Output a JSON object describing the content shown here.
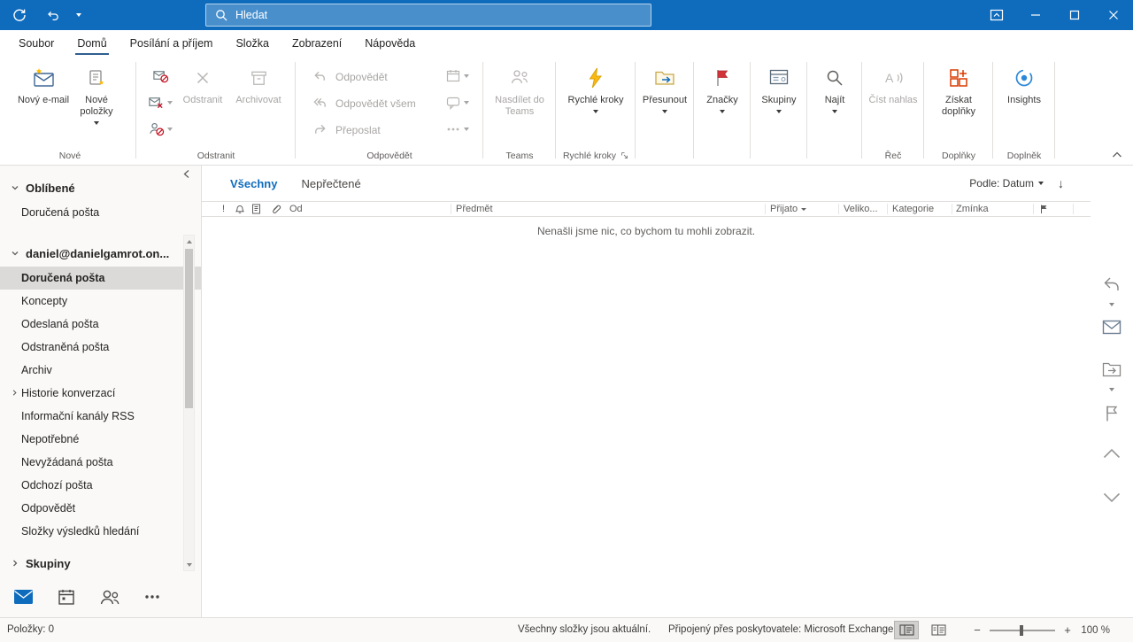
{
  "titlebar": {
    "search_placeholder": "Hledat"
  },
  "menubar": {
    "tabs": [
      {
        "label": "Soubor"
      },
      {
        "label": "Domů",
        "active": true
      },
      {
        "label": "Posílání a příjem"
      },
      {
        "label": "Složka"
      },
      {
        "label": "Zobrazení"
      },
      {
        "label": "Nápověda"
      }
    ]
  },
  "ribbon": {
    "new_email": "Nový e-mail",
    "new_items": "Nové položky",
    "delete": "Odstranit",
    "archive": "Archivovat",
    "reply": "Odpovědět",
    "reply_all": "Odpovědět všem",
    "forward": "Přeposlat",
    "share_to_teams": "Nasdílet do Teams",
    "quick_steps": "Rychlé kroky",
    "move": "Přesunout",
    "tags": "Značky",
    "groups": "Skupiny",
    "find": "Najít",
    "read_aloud": "Číst nahlas",
    "get_addins": "Získat doplňky",
    "insights": "Insights",
    "group_labels": {
      "new": "Nové",
      "delete": "Odstranit",
      "respond": "Odpovědět",
      "teams": "Teams",
      "quick_steps": "Rychlé kroky",
      "speech": "Řeč",
      "addins": "Doplňky",
      "addin": "Doplněk"
    }
  },
  "folder_pane": {
    "favorites_header": "Oblíbené",
    "favorites": [
      {
        "label": "Doručená pošta"
      }
    ],
    "account_header": "daniel@danielgamrot.on...",
    "folders": [
      {
        "label": "Doručená pošta",
        "selected": true
      },
      {
        "label": "Koncepty"
      },
      {
        "label": "Odeslaná pošta"
      },
      {
        "label": "Odstraněná pošta"
      },
      {
        "label": "Archiv"
      },
      {
        "label": "Historie konverzací",
        "expandable": true
      },
      {
        "label": "Informační kanály RSS"
      },
      {
        "label": "Nepotřebné"
      },
      {
        "label": "Nevyžádaná pošta"
      },
      {
        "label": "Odchozí pošta"
      },
      {
        "label": "Odpovědět"
      },
      {
        "label": "Složky výsledků hledání"
      }
    ],
    "groups_header": "Skupiny"
  },
  "message_list": {
    "tab_all": "Všechny",
    "tab_unread": "Nepřečtené",
    "sort_label": "Podle: Datum",
    "columns": {
      "importance": "!",
      "from": "Od",
      "subject": "Předmět",
      "received": "Přijato",
      "size": "Veliko...",
      "category": "Kategorie",
      "mention": "Zmínka"
    },
    "empty_message": "Nenašli jsme nic, co bychom tu mohli zobrazit."
  },
  "status_bar": {
    "items_count": "Položky: 0",
    "folders_status": "Všechny složky jsou aktuální.",
    "connection": "Připojený přes poskytovatele: Microsoft Exchange",
    "zoom_level": "100 %"
  },
  "glyphs": {
    "sort_down_arrow": "↓",
    "zoom_minus": "−",
    "zoom_plus": "+"
  },
  "colors": {
    "titlebar": "#0f6cbd",
    "accent": "#0f6cbd",
    "flag_red": "#d13438",
    "bolt_yellow": "#fdb913",
    "addin_orange": "#d83b01"
  }
}
